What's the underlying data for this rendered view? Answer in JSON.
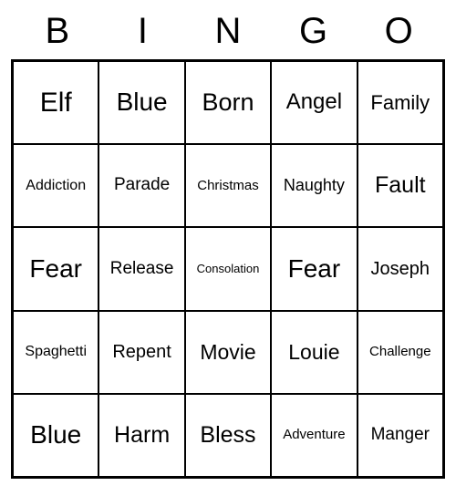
{
  "header": [
    "B",
    "I",
    "N",
    "G",
    "O"
  ],
  "grid": [
    [
      {
        "text": "Elf",
        "size": 30
      },
      {
        "text": "Blue",
        "size": 28
      },
      {
        "text": "Born",
        "size": 27
      },
      {
        "text": "Angel",
        "size": 24
      },
      {
        "text": "Family",
        "size": 22
      }
    ],
    [
      {
        "text": "Addiction",
        "size": 16
      },
      {
        "text": "Parade",
        "size": 19
      },
      {
        "text": "Christmas",
        "size": 15
      },
      {
        "text": "Naughty",
        "size": 18
      },
      {
        "text": "Fault",
        "size": 25
      }
    ],
    [
      {
        "text": "Fear",
        "size": 28
      },
      {
        "text": "Release",
        "size": 19
      },
      {
        "text": "Consolation",
        "size": 13
      },
      {
        "text": "Fear",
        "size": 28
      },
      {
        "text": "Joseph",
        "size": 20
      }
    ],
    [
      {
        "text": "Spaghetti",
        "size": 16
      },
      {
        "text": "Repent",
        "size": 20
      },
      {
        "text": "Movie",
        "size": 23
      },
      {
        "text": "Louie",
        "size": 23
      },
      {
        "text": "Challenge",
        "size": 15
      }
    ],
    [
      {
        "text": "Blue",
        "size": 28
      },
      {
        "text": "Harm",
        "size": 25
      },
      {
        "text": "Bless",
        "size": 25
      },
      {
        "text": "Adventure",
        "size": 15
      },
      {
        "text": "Manger",
        "size": 19
      }
    ]
  ]
}
